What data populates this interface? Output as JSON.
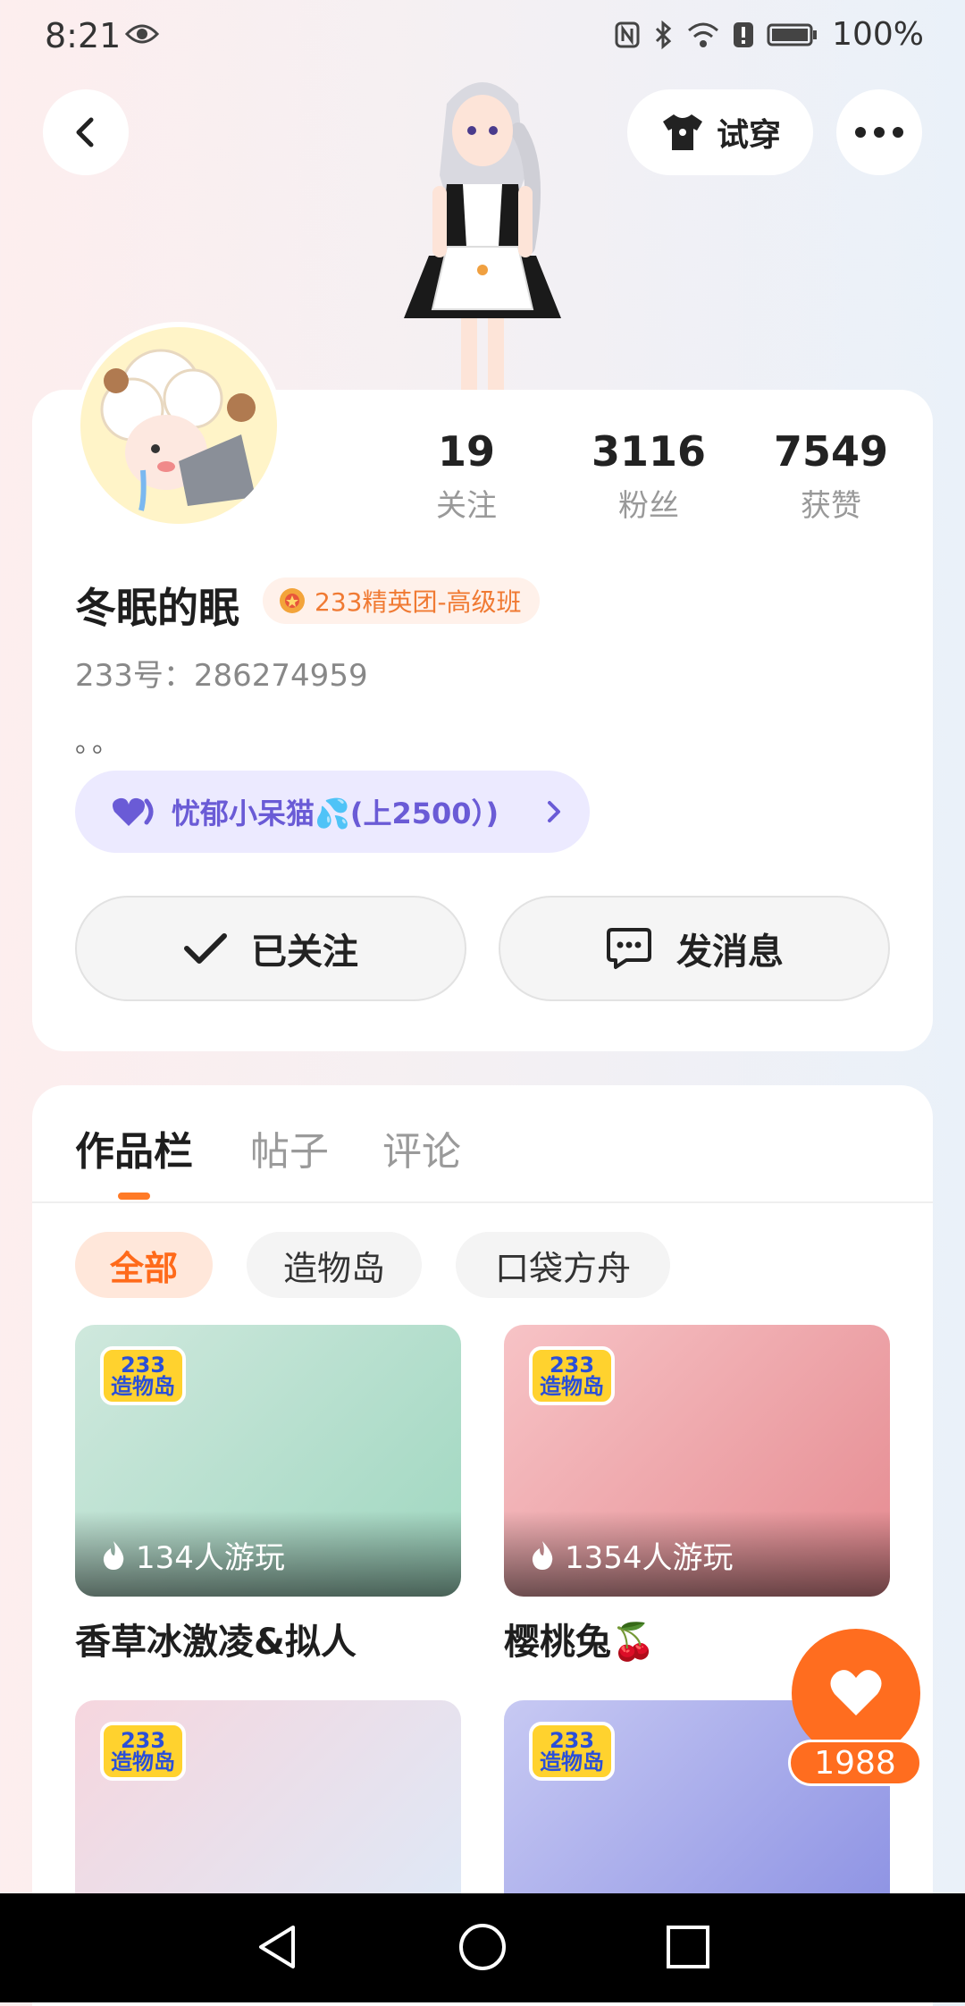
{
  "status_bar": {
    "time": "8:21",
    "battery": "100%"
  },
  "header": {
    "try_on_label": "试穿"
  },
  "profile": {
    "stats": [
      {
        "value": "19",
        "label": "关注"
      },
      {
        "value": "3116",
        "label": "粉丝"
      },
      {
        "value": "7549",
        "label": "获赞"
      }
    ],
    "username": "冬眠的眠",
    "badge": "233精英团-高级班",
    "user_id": "233号：286274959",
    "bio": "。。",
    "group": "忧郁小呆猫💦(上2500）)",
    "followed_label": "已关注",
    "message_label": "发消息"
  },
  "tabs": {
    "works": "作品栏",
    "posts": "帖子",
    "comments": "评论"
  },
  "chips": {
    "all": "全部",
    "zaowudao": "造物岛",
    "koudai": "口袋方舟"
  },
  "logo_text": {
    "line1": "233",
    "line2": "造物岛"
  },
  "works": [
    {
      "plays": "134人游玩",
      "title": "香草冰激凌&拟人",
      "colors": [
        "#cfe8dd",
        "#9fd7c0"
      ]
    },
    {
      "plays": "1354人游玩",
      "title": "樱桃兔🍒",
      "colors": [
        "#f7c3c6",
        "#e58a90"
      ]
    },
    {
      "colors": [
        "#f6d6de",
        "#dfe8f6"
      ]
    },
    {
      "colors": [
        "#c7c9f3",
        "#8f94e4"
      ]
    }
  ],
  "like": {
    "count": "1988"
  },
  "colors": {
    "accent": "#ff6d1f",
    "group_purple": "#6a5bd6"
  }
}
